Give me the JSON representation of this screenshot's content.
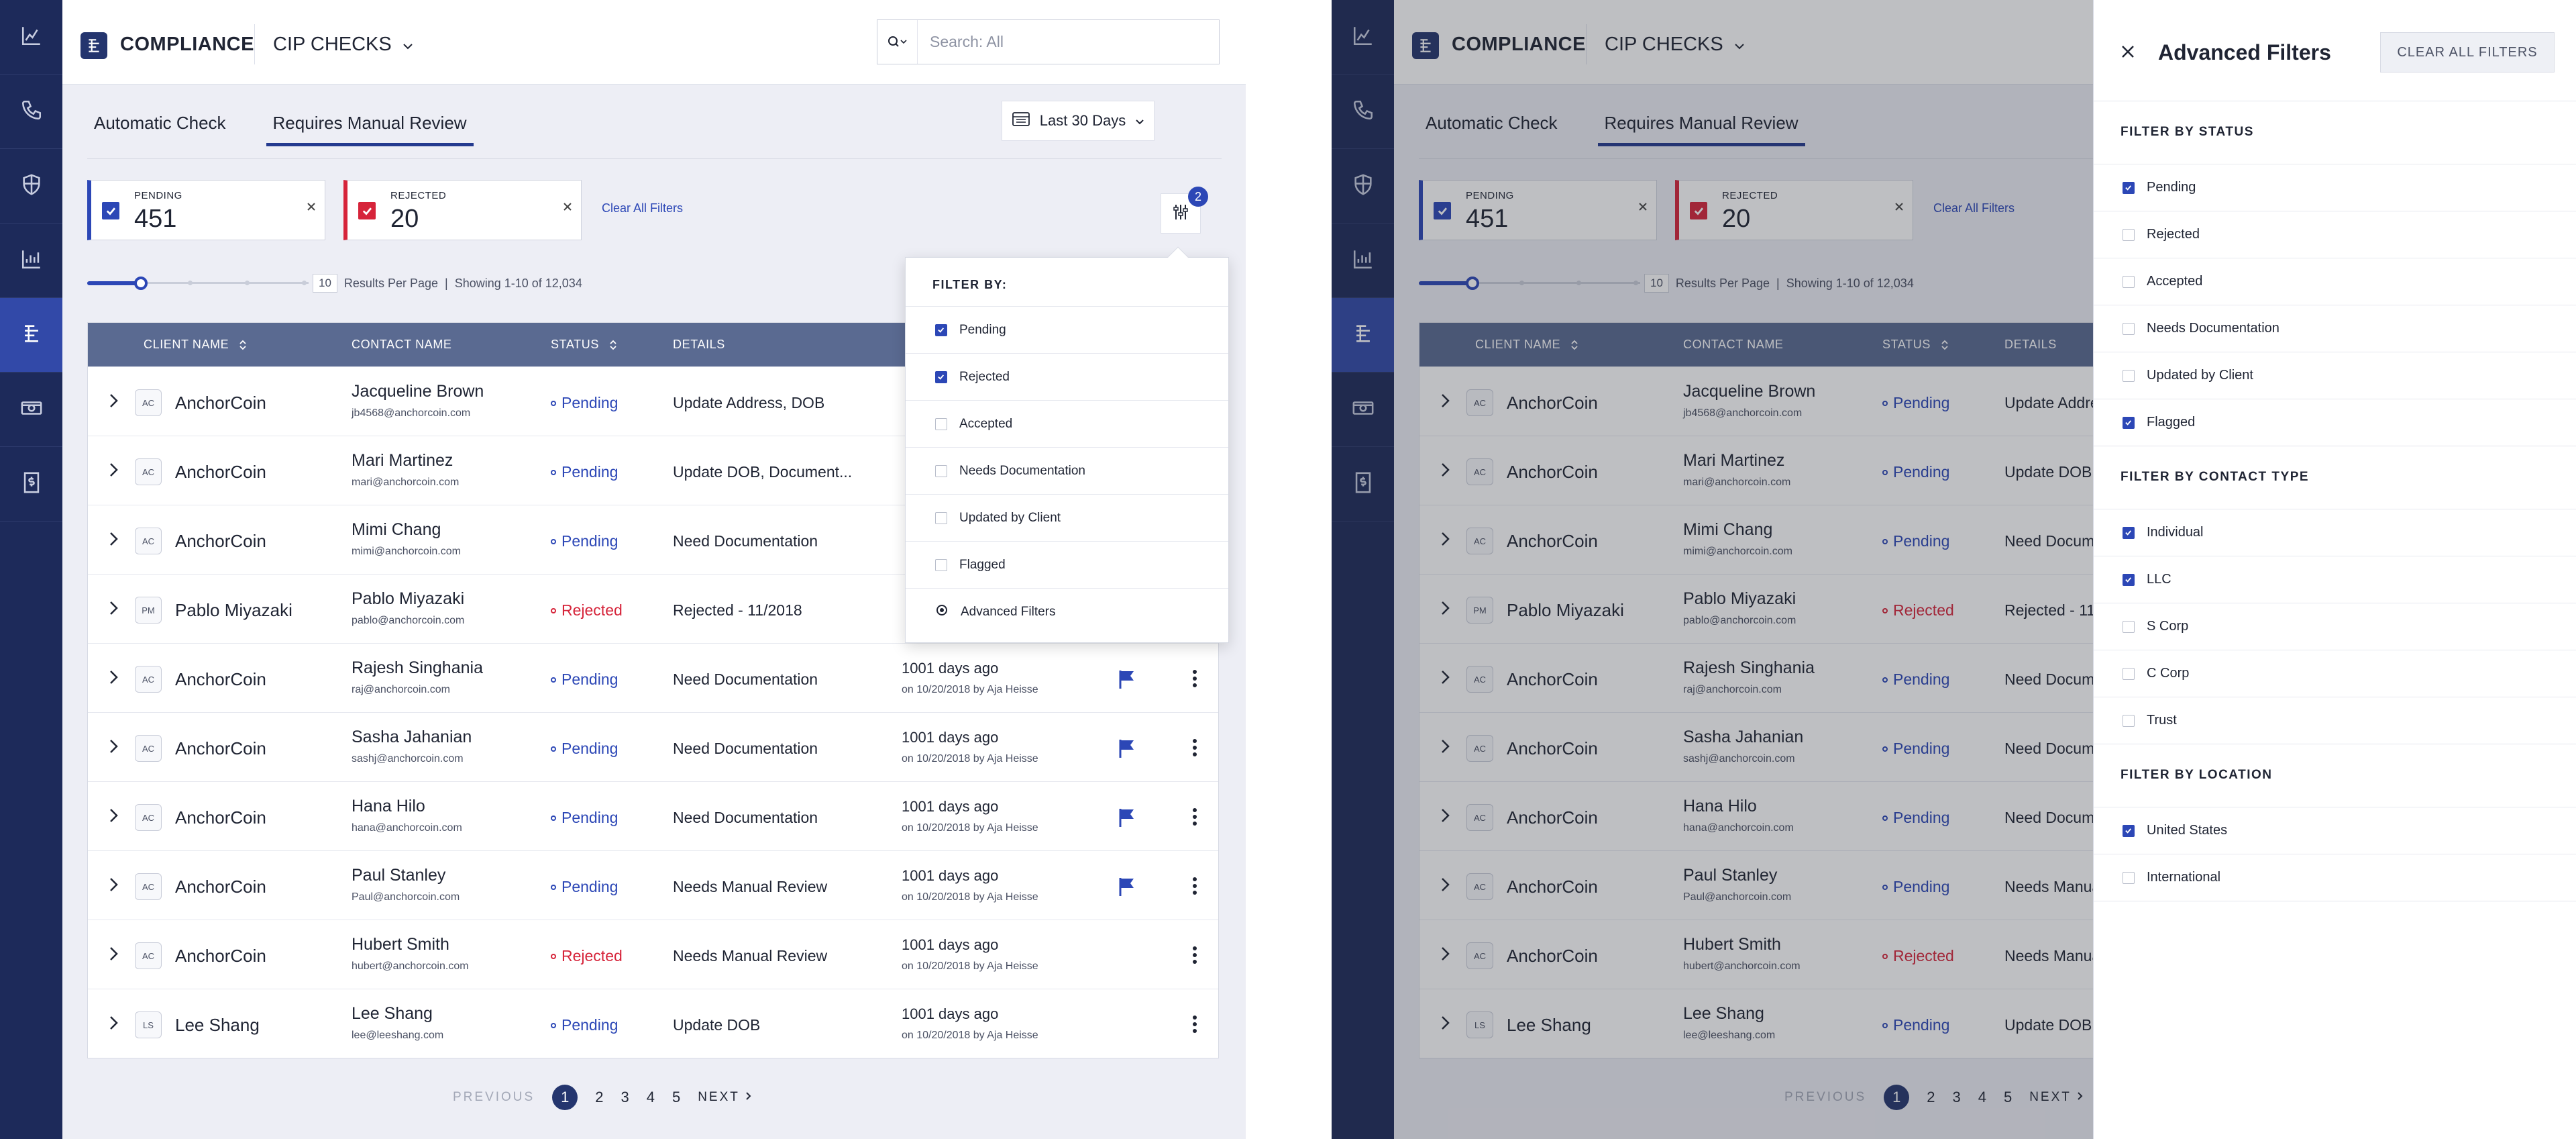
{
  "app": {
    "title": "COMPLIANCE",
    "section": "CIP CHECKS",
    "search_placeholder": "Search: All"
  },
  "nav_icons": [
    "chart-icon",
    "phone-icon",
    "shield-icon",
    "bar-chart-icon",
    "compliance-icon",
    "money-icon",
    "document-dollar-icon"
  ],
  "tabs": [
    {
      "label": "Automatic Check"
    },
    {
      "label": "Requires Manual Review"
    }
  ],
  "date_filter": "Last 30 Days",
  "chips": [
    {
      "label": "PENDING",
      "count": "451",
      "color": "#2c47b6"
    },
    {
      "label": "REJECTED",
      "count": "20",
      "color": "#d6243a"
    }
  ],
  "clear_all_filters": "Clear All Filters",
  "filter_badge": "2",
  "results": {
    "per_page": "10",
    "per_page_label": "Results Per Page",
    "showing": "Showing 1-10 of 12,034",
    "sep": "|"
  },
  "columns": {
    "client": "CLIENT NAME",
    "contact": "CONTACT NAME",
    "status": "STATUS",
    "details": "DETAILS"
  },
  "rows": [
    {
      "initials": "AC",
      "client": "AnchorCoin",
      "contact": "Jacqueline Brown",
      "email": "jb4568@anchorcoin.com",
      "status": "Pending",
      "details": "Update Address, DOB",
      "when": "",
      "on": "",
      "flag": false
    },
    {
      "initials": "AC",
      "client": "AnchorCoin",
      "contact": "Mari Martinez",
      "email": "mari@anchorcoin.com",
      "status": "Pending",
      "details": "Update DOB, Document...",
      "when": "",
      "on": "",
      "flag": false
    },
    {
      "initials": "AC",
      "client": "AnchorCoin",
      "contact": "Mimi Chang",
      "email": "mimi@anchorcoin.com",
      "status": "Pending",
      "details": "Need Documentation",
      "when": "",
      "on": "",
      "flag": false
    },
    {
      "initials": "PM",
      "client": "Pablo Miyazaki",
      "contact": "Pablo Miyazaki",
      "email": "pablo@anchorcoin.com",
      "status": "Rejected",
      "details": "Rejected - 11/2018",
      "when": "",
      "on": "",
      "flag": false
    },
    {
      "initials": "AC",
      "client": "AnchorCoin",
      "contact": "Rajesh Singhania",
      "email": "raj@anchorcoin.com",
      "status": "Pending",
      "details": "Need Documentation",
      "when": "1001 days ago",
      "on": "on 10/20/2018 by Aja Heisse",
      "flag": true
    },
    {
      "initials": "AC",
      "client": "AnchorCoin",
      "contact": "Sasha Jahanian",
      "email": "sashj@anchorcoin.com",
      "status": "Pending",
      "details": "Need Documentation",
      "when": "1001 days ago",
      "on": "on 10/20/2018 by Aja Heisse",
      "flag": true
    },
    {
      "initials": "AC",
      "client": "AnchorCoin",
      "contact": "Hana Hilo",
      "email": "hana@anchorcoin.com",
      "status": "Pending",
      "details": "Need Documentation",
      "when": "1001 days ago",
      "on": "on 10/20/2018 by Aja Heisse",
      "flag": true
    },
    {
      "initials": "AC",
      "client": "AnchorCoin",
      "contact": "Paul Stanley",
      "email": "Paul@anchorcoin.com",
      "status": "Pending",
      "details": "Needs Manual Review",
      "when": "1001 days ago",
      "on": "on 10/20/2018 by Aja Heisse",
      "flag": true
    },
    {
      "initials": "AC",
      "client": "AnchorCoin",
      "contact": "Hubert Smith",
      "email": "hubert@anchorcoin.com",
      "status": "Rejected",
      "details": "Needs Manual Review",
      "when": "1001 days ago",
      "on": "on 10/20/2018 by Aja Heisse",
      "flag": false
    },
    {
      "initials": "LS",
      "client": "Lee Shang",
      "contact": "Lee Shang",
      "email": "lee@leeshang.com",
      "status": "Pending",
      "details": "Update DOB",
      "when": "1001 days ago",
      "on": "on 10/20/2018 by Aja Heisse",
      "flag": false
    }
  ],
  "pagination": {
    "previous": "PREVIOUS",
    "next": "NEXT",
    "pages": [
      "1",
      "2",
      "3",
      "4",
      "5"
    ],
    "current": "1"
  },
  "filter_dropdown": {
    "title": "FILTER BY:",
    "options": [
      {
        "label": "Pending",
        "checked": true
      },
      {
        "label": "Rejected",
        "checked": true
      },
      {
        "label": "Accepted",
        "checked": false
      },
      {
        "label": "Needs Documentation",
        "checked": false
      },
      {
        "label": "Updated by Client",
        "checked": false
      },
      {
        "label": "Flagged",
        "checked": false
      }
    ],
    "advanced_link": "Advanced Filters"
  },
  "advanced_panel": {
    "title": "Advanced Filters",
    "clear_button": "CLEAR ALL FILTERS",
    "sections": [
      {
        "title": "FILTER BY STATUS",
        "options": [
          {
            "label": "Pending",
            "checked": true
          },
          {
            "label": "Rejected",
            "checked": false
          },
          {
            "label": "Accepted",
            "checked": false
          },
          {
            "label": "Needs Documentation",
            "checked": false
          },
          {
            "label": "Updated by Client",
            "checked": false
          },
          {
            "label": "Flagged",
            "checked": true
          }
        ]
      },
      {
        "title": "FILTER BY CONTACT TYPE",
        "options": [
          {
            "label": "Individual",
            "checked": true
          },
          {
            "label": "LLC",
            "checked": true
          },
          {
            "label": "S Corp",
            "checked": false
          },
          {
            "label": "C Corp",
            "checked": false
          },
          {
            "label": "Trust",
            "checked": false
          }
        ]
      },
      {
        "title": "FILTER BY LOCATION",
        "options": [
          {
            "label": "United States",
            "checked": true
          },
          {
            "label": "International",
            "checked": false
          }
        ]
      }
    ]
  },
  "colors": {
    "nav": "#1d2a5a",
    "accent": "#2c47b6",
    "pending": "#2c47b6",
    "rejected": "#d6243a",
    "table_header": "#5a6a91"
  }
}
